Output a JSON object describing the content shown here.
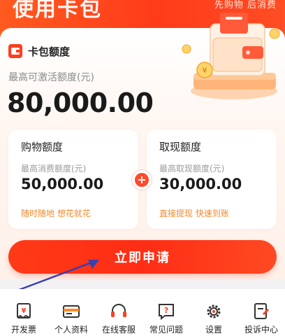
{
  "banner": {
    "title": "使用卡包",
    "slogan": "先购物 后消费"
  },
  "card": {
    "title": "卡包额度",
    "limit_label": "最高可激活额度(元)",
    "limit_value": "80,000.00"
  },
  "shopping": {
    "title": "购物额度",
    "label": "最高消费额度(元)",
    "value": "50,000.00",
    "tag": "随时随地 想花就花"
  },
  "cash": {
    "title": "取现额度",
    "label": "最高取现额度(元)",
    "value": "30,000.00",
    "tag": "直接提现 快速到账"
  },
  "plus_symbol": "+",
  "apply_button": "立即申请",
  "bottom_nav": {
    "items": [
      {
        "label": "开发票",
        "icon": "invoice-icon"
      },
      {
        "label": "个人资料",
        "icon": "id-card-icon"
      },
      {
        "label": "在线客服",
        "icon": "headset-icon"
      },
      {
        "label": "常见问题",
        "icon": "faq-icon"
      },
      {
        "label": "设置",
        "icon": "gear-icon"
      },
      {
        "label": "投诉中心",
        "icon": "complaint-icon"
      }
    ]
  },
  "colors": {
    "accent": "#ff3d1f",
    "tag": "#f08a2c",
    "annotation_arrow": "#3a3fb0"
  }
}
